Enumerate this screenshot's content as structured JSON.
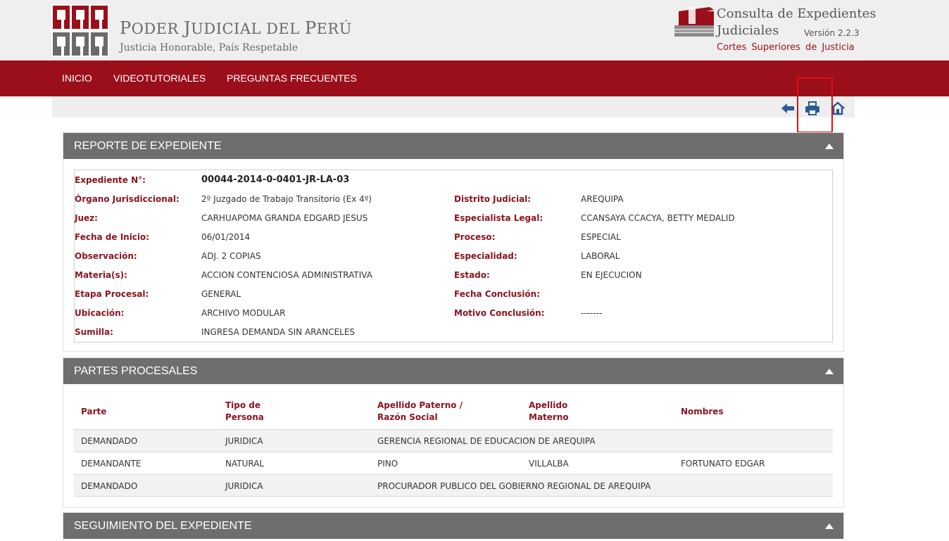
{
  "header": {
    "org_name_first": "P",
    "org_name_rest1": "ODER ",
    "org_name_j": "J",
    "org_name_rest2": "UDICIAL DEL ",
    "org_name_p": "P",
    "org_name_rest3": "ERÚ",
    "org_tagline": "Justicia Honorable, País Respetable",
    "app_title_line1": "Consulta de Expedientes",
    "app_title_line2": "Judiciales",
    "app_version": "Versión 2.2.3",
    "app_subtitle": "Cortes Superiores de Justicia"
  },
  "nav": {
    "items": [
      "INICIO",
      "VIDEOTUTORIALES",
      "PREGUNTAS FRECUENTES"
    ]
  },
  "toolbar": {
    "back_icon": "arrow-left-icon",
    "print_icon": "printer-icon",
    "home_icon": "home-icon"
  },
  "colors": {
    "brand_red": "#9b0f1a",
    "panel_gray": "#6e6e6e",
    "label_red": "#8c1421",
    "highlight": "#e01010"
  },
  "report": {
    "title": "REPORTE DE EXPEDIENTE",
    "expediente_label": "Expediente N°:",
    "expediente_value": "00044-2014-0-0401-JR-LA-03",
    "left": [
      {
        "label": "Órgano Jurisdiccional:",
        "value": "2º Juzgado de Trabajo Transitorio (Ex 4º)"
      },
      {
        "label": "Juez:",
        "value": "CARHUAPOMA GRANDA EDGARD JESUS"
      },
      {
        "label": "Fecha de Inicio:",
        "value": "06/01/2014"
      },
      {
        "label": "Observación:",
        "value": "ADJ. 2 COPIAS"
      },
      {
        "label": "Materia(s):",
        "value": "ACCION CONTENCIOSA ADMINISTRATIVA"
      },
      {
        "label": "Etapa Procesal:",
        "value": "GENERAL"
      },
      {
        "label": "Ubicación:",
        "value": "ARCHIVO MODULAR"
      },
      {
        "label": "Sumilla:",
        "value": "INGRESA DEMANDA SIN ARANCELES"
      }
    ],
    "right": [
      {
        "label": "Distrito Judicial:",
        "value": "AREQUIPA"
      },
      {
        "label": "Especialista Legal:",
        "value": "CCANSAYA CCACYA, BETTY MEDALID"
      },
      {
        "label": "Proceso:",
        "value": "ESPECIAL"
      },
      {
        "label": "Especialidad:",
        "value": "LABORAL"
      },
      {
        "label": "Estado:",
        "value": "EN EJECUCION"
      },
      {
        "label": "Fecha Conclusión:",
        "value": ""
      },
      {
        "label": "Motivo Conclusión:",
        "value": "-------"
      }
    ]
  },
  "partes": {
    "title": "PARTES PROCESALES",
    "headers": [
      [
        "Parte"
      ],
      [
        "Tipo de",
        "Persona"
      ],
      [
        "Apellido Paterno /",
        "Razón Social"
      ],
      [
        "Apellido",
        "Materno"
      ],
      [
        "Nombres"
      ]
    ],
    "rows": [
      [
        "DEMANDADO",
        "JURIDICA",
        "GERENCIA REGIONAL DE EDUCACION DE AREQUIPA",
        "",
        ""
      ],
      [
        "DEMANDANTE",
        "NATURAL",
        "PINO",
        "VILLALBA",
        "FORTUNATO EDGAR"
      ],
      [
        "DEMANDADO",
        "JURIDICA",
        "PROCURADOR PUBLICO DEL GOBIERNO REGIONAL DE AREQUIPA",
        "",
        ""
      ]
    ]
  },
  "seguimiento": {
    "title": "SEGUIMIENTO DEL EXPEDIENTE"
  }
}
